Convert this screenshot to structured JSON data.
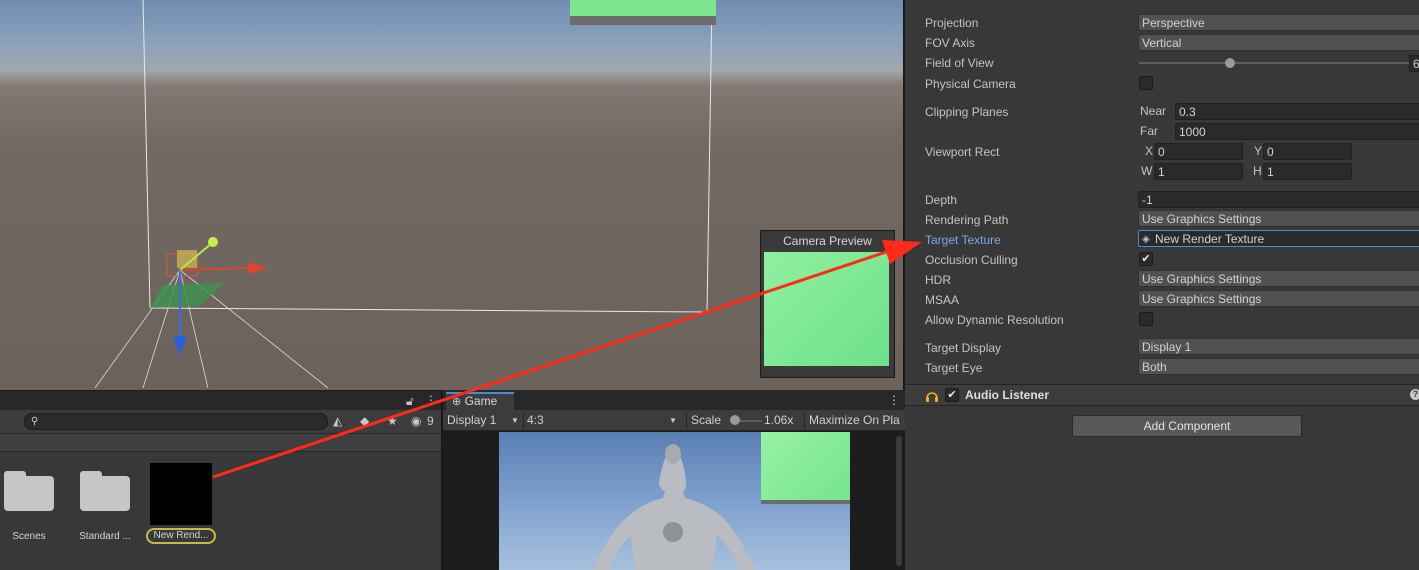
{
  "scene": {
    "camera_preview_title": "Camera Preview"
  },
  "inspector": {
    "projection": {
      "label": "Projection",
      "value": "Perspective"
    },
    "fov_axis": {
      "label": "FOV Axis",
      "value": "Vertical"
    },
    "field_of_view": {
      "label": "Field of View",
      "value": "6"
    },
    "physical_camera": {
      "label": "Physical Camera",
      "checked": false
    },
    "clipping_planes": {
      "label": "Clipping Planes",
      "near_label": "Near",
      "near": "0.3",
      "far_label": "Far",
      "far": "1000"
    },
    "viewport_rect": {
      "label": "Viewport Rect",
      "x_label": "X",
      "x": "0",
      "y_label": "Y",
      "y": "0",
      "w_label": "W",
      "w": "1",
      "h_label": "H",
      "h": "1"
    },
    "depth": {
      "label": "Depth",
      "value": "-1"
    },
    "rendering_path": {
      "label": "Rendering Path",
      "value": "Use Graphics Settings"
    },
    "target_texture": {
      "label": "Target Texture",
      "value": "New Render Texture"
    },
    "occlusion_culling": {
      "label": "Occlusion Culling",
      "checked": true
    },
    "hdr": {
      "label": "HDR",
      "value": "Use Graphics Settings"
    },
    "msaa": {
      "label": "MSAA",
      "value": "Use Graphics Settings"
    },
    "allow_dynamic_resolution": {
      "label": "Allow Dynamic Resolution",
      "checked": false
    },
    "target_display": {
      "label": "Target Display",
      "value": "Display 1"
    },
    "target_eye": {
      "label": "Target Eye",
      "value": "Both"
    },
    "audio_listener": {
      "label": "Audio Listener",
      "enabled": true
    },
    "add_component": "Add Component",
    "check_mark": "✔"
  },
  "project": {
    "hidden_count": "9",
    "assets": [
      {
        "name": "Scenes",
        "type": "folder"
      },
      {
        "name": "Standard ...",
        "type": "folder"
      },
      {
        "name": "New Rend...",
        "type": "render-texture"
      }
    ]
  },
  "game": {
    "tab_label": "Game",
    "display": "Display 1",
    "aspect": "4:3",
    "scale_label": "Scale",
    "scale_value": "1.06x",
    "maximize_label": "Maximize On Pla"
  },
  "colors": {
    "annotation_arrow": "#ff2a1a",
    "camera_preview_green": "#8ff0a0",
    "selection_outline": "#c8b94a",
    "link_label": "#7ba7ee"
  }
}
